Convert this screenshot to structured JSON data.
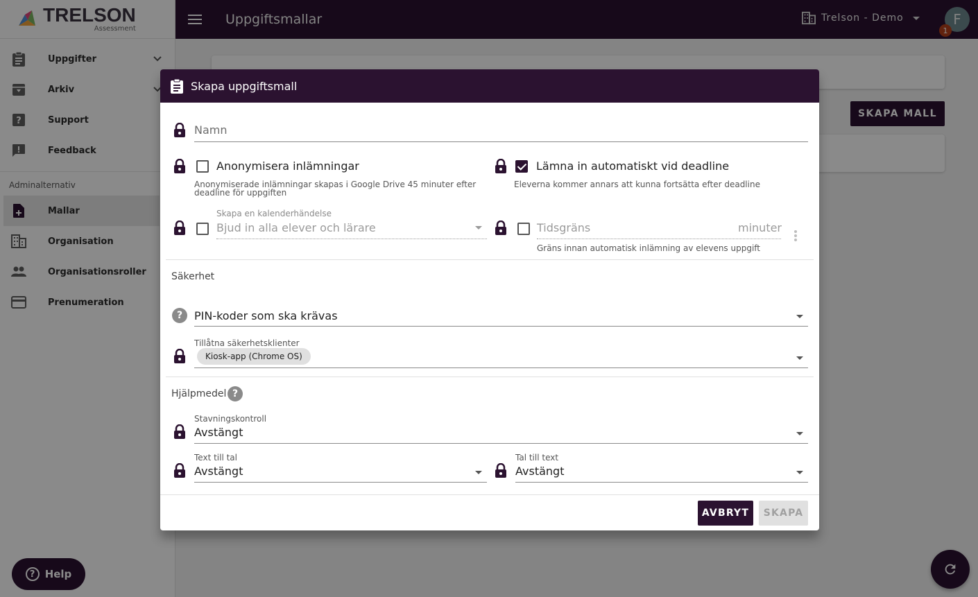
{
  "app": {
    "brand_name": "TRELSON",
    "brand_sub": "Assessment",
    "page_title": "Uppgiftsmallar",
    "org_name": "Trelson - Demo",
    "avatar_initial": "F",
    "notification_count": "1"
  },
  "sidebar": {
    "items": [
      {
        "label": "Uppgifter",
        "icon": "clipboard-icon"
      },
      {
        "label": "Arkiv",
        "icon": "archive-icon"
      },
      {
        "label": "Support",
        "icon": "help-box-icon"
      },
      {
        "label": "Feedback",
        "icon": "feedback-icon"
      }
    ],
    "section_label": "Adminalternativ",
    "admin_items": [
      {
        "label": "Mallar",
        "icon": "file-plus-icon"
      },
      {
        "label": "Organisation",
        "icon": "domain-icon"
      },
      {
        "label": "Organisationsroller",
        "icon": "people-icon"
      },
      {
        "label": "Prenumeration",
        "icon": "credit-card-icon"
      }
    ],
    "help_label": "Help"
  },
  "main": {
    "create_button": "SKAPA MALL"
  },
  "dialog": {
    "title": "Skapa uppgiftsmall",
    "name_placeholder": "Namn",
    "anonymize_label": "Anonymisera inlämningar",
    "anonymize_hint": "Anonymiserade inlämningar skapas i Google Drive 45 minuter efter deadline för uppgiften",
    "auto_submit_label": "Lämna in automatiskt vid deadline",
    "auto_submit_hint": "Eleverna kommer annars att kunna fortsätta efter deadline",
    "calendar_label": "Skapa en kalenderhändelse",
    "calendar_placeholder": "Bjud in alla elever och lärare",
    "time_limit_placeholder": "Tidsgräns",
    "time_limit_suffix": "minuter",
    "time_limit_hint": "Gräns innan automatisk inlämning av elevens uppgift",
    "security_title": "Säkerhet",
    "pin_placeholder": "PIN-koder som ska krävas",
    "clients_label": "Tillåtna säkerhetsklienter",
    "clients_chip": "Kiosk-app (Chrome OS)",
    "aids_title": "Hjälpmedel",
    "spellcheck_label": "Stavningskontroll",
    "spellcheck_value": "Avstängt",
    "tts_label": "Text till tal",
    "tts_value": "Avstängt",
    "stt_label": "Tal till text",
    "stt_value": "Avstängt",
    "cancel_button": "AVBRYT",
    "create_button": "SKAPA",
    "anonymize_checked": false,
    "auto_submit_checked": true,
    "calendar_checked": false,
    "time_limit_checked": false
  },
  "colors": {
    "brand_dark": "#2b1230",
    "notification": "#b3401a"
  }
}
